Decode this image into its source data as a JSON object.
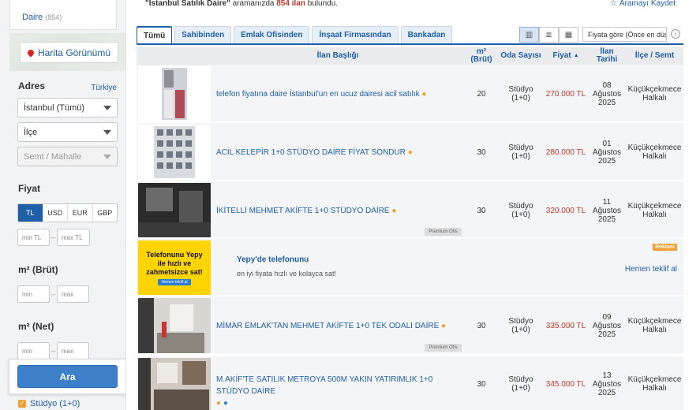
{
  "sidebar": {
    "category": {
      "label": "Daire",
      "count": "(854)"
    },
    "map_button": "Harita Görünümü",
    "address": {
      "title": "Adres",
      "country_link": "Türkiye",
      "city": "İstanbul (Tümü)",
      "district": "İlçe",
      "neighborhood": "Semt / Mahalle"
    },
    "price": {
      "title": "Fiyat",
      "currencies": [
        "TL",
        "USD",
        "EUR",
        "GBP"
      ],
      "active_currency": "TL",
      "min_placeholder": "min TL",
      "max_placeholder": "max TL"
    },
    "gross_area": {
      "title": "m² (Brüt)",
      "min_placeholder": "min",
      "max_placeholder": "max"
    },
    "net_area": {
      "title": "m² (Net)",
      "min_placeholder": "min",
      "max_placeholder": "max"
    },
    "search_button": "Ara",
    "room_option": {
      "label": "Stüdyo (1+0)",
      "checked": true
    }
  },
  "topbar": {
    "query": "\"İstanbul Satılık Daire\"",
    "mid_text": " aramanızda ",
    "count": "854 ilan",
    "end_text": " bulundu.",
    "save_search": "Aramayı Kaydet"
  },
  "tabs": [
    "Tümü",
    "Sahibinden",
    "Emlak Ofisinden",
    "İnşaat Firmasından",
    "Bankadan"
  ],
  "active_tab": "Tümü",
  "sort_select": "Fiyata göre (Önce en düşük)",
  "columns": {
    "title": "İlan Başlığı",
    "area": "m²",
    "area_sub": "(Brüt)",
    "rooms": "Oda Sayısı",
    "price": "Fiyat",
    "date": "İlan Tarihi",
    "location": "İlçe / Semt"
  },
  "listings": [
    {
      "title": "telefon fiyatına daire İstanbul'un en ucuz dairesi acil satılık",
      "area": "20",
      "rooms": [
        "Stüdyo",
        "(1+0)"
      ],
      "price": "270.000 TL",
      "date": [
        "08",
        "Ağustos",
        "2025"
      ],
      "location": [
        "Küçükçekmece",
        "Halkalı"
      ],
      "premium": ""
    },
    {
      "title": "ACİL KELEPİR 1+0 STÜDYO DAİRE FİYAT SONDUR",
      "area": "30",
      "rooms": [
        "Stüdyo",
        "(1+0)"
      ],
      "price": "280.000 TL",
      "date": [
        "01",
        "Ağustos",
        "2025"
      ],
      "location": [
        "Küçükçekmece",
        "Halkalı"
      ],
      "premium": ""
    },
    {
      "title": "İKİTELLİ MEHMET AKİFTE 1+0 STÜDYO DAİRE",
      "area": "30",
      "rooms": [
        "Stüdyo",
        "(1+0)"
      ],
      "price": "320.000 TL",
      "date": [
        "11",
        "Ağustos",
        "2025"
      ],
      "location": [
        "Küçükçekmece",
        "Halkalı"
      ],
      "premium": "Premium Ofis"
    },
    {
      "title": "MİMAR EMLAK'TAN MEHMET AKİFTE 1+0 TEK ODALI DAİRE",
      "area": "30",
      "rooms": [
        "Stüdyo",
        "(1+0)"
      ],
      "price": "335.000 TL",
      "date": [
        "09",
        "Ağustos",
        "2025"
      ],
      "location": [
        "Küçükçekmece",
        "Halkalı"
      ],
      "premium": "Premium Ofis"
    },
    {
      "title": "M.AKİF'TE SATILIK METROYA 500M YAKIN YATIRIMLIK 1+0 STÜDYO DAİRE",
      "area": "30",
      "rooms": [
        "Stüdyo",
        "(1+0)"
      ],
      "price": "345.000 TL",
      "date": [
        "13",
        "Ağustos",
        "2025"
      ],
      "location": [
        "Küçükçekmece",
        "Halkalı"
      ],
      "premium": ""
    }
  ],
  "ad": {
    "image_text": "Telefonunu Yepy ile hızlı ve zahmetsizce sat!",
    "image_button": "Hemen teklif al",
    "title": "Yepy'de telefonunu",
    "description": "en iyi fiyata hızlı ve kolayca sat!",
    "badge": "Reklam",
    "link": "Hemen teklif al"
  },
  "colors": {
    "link": "#1f5fa8",
    "price": "#c0392b",
    "accent": "#f0a030",
    "button": "#3d7fc9"
  }
}
